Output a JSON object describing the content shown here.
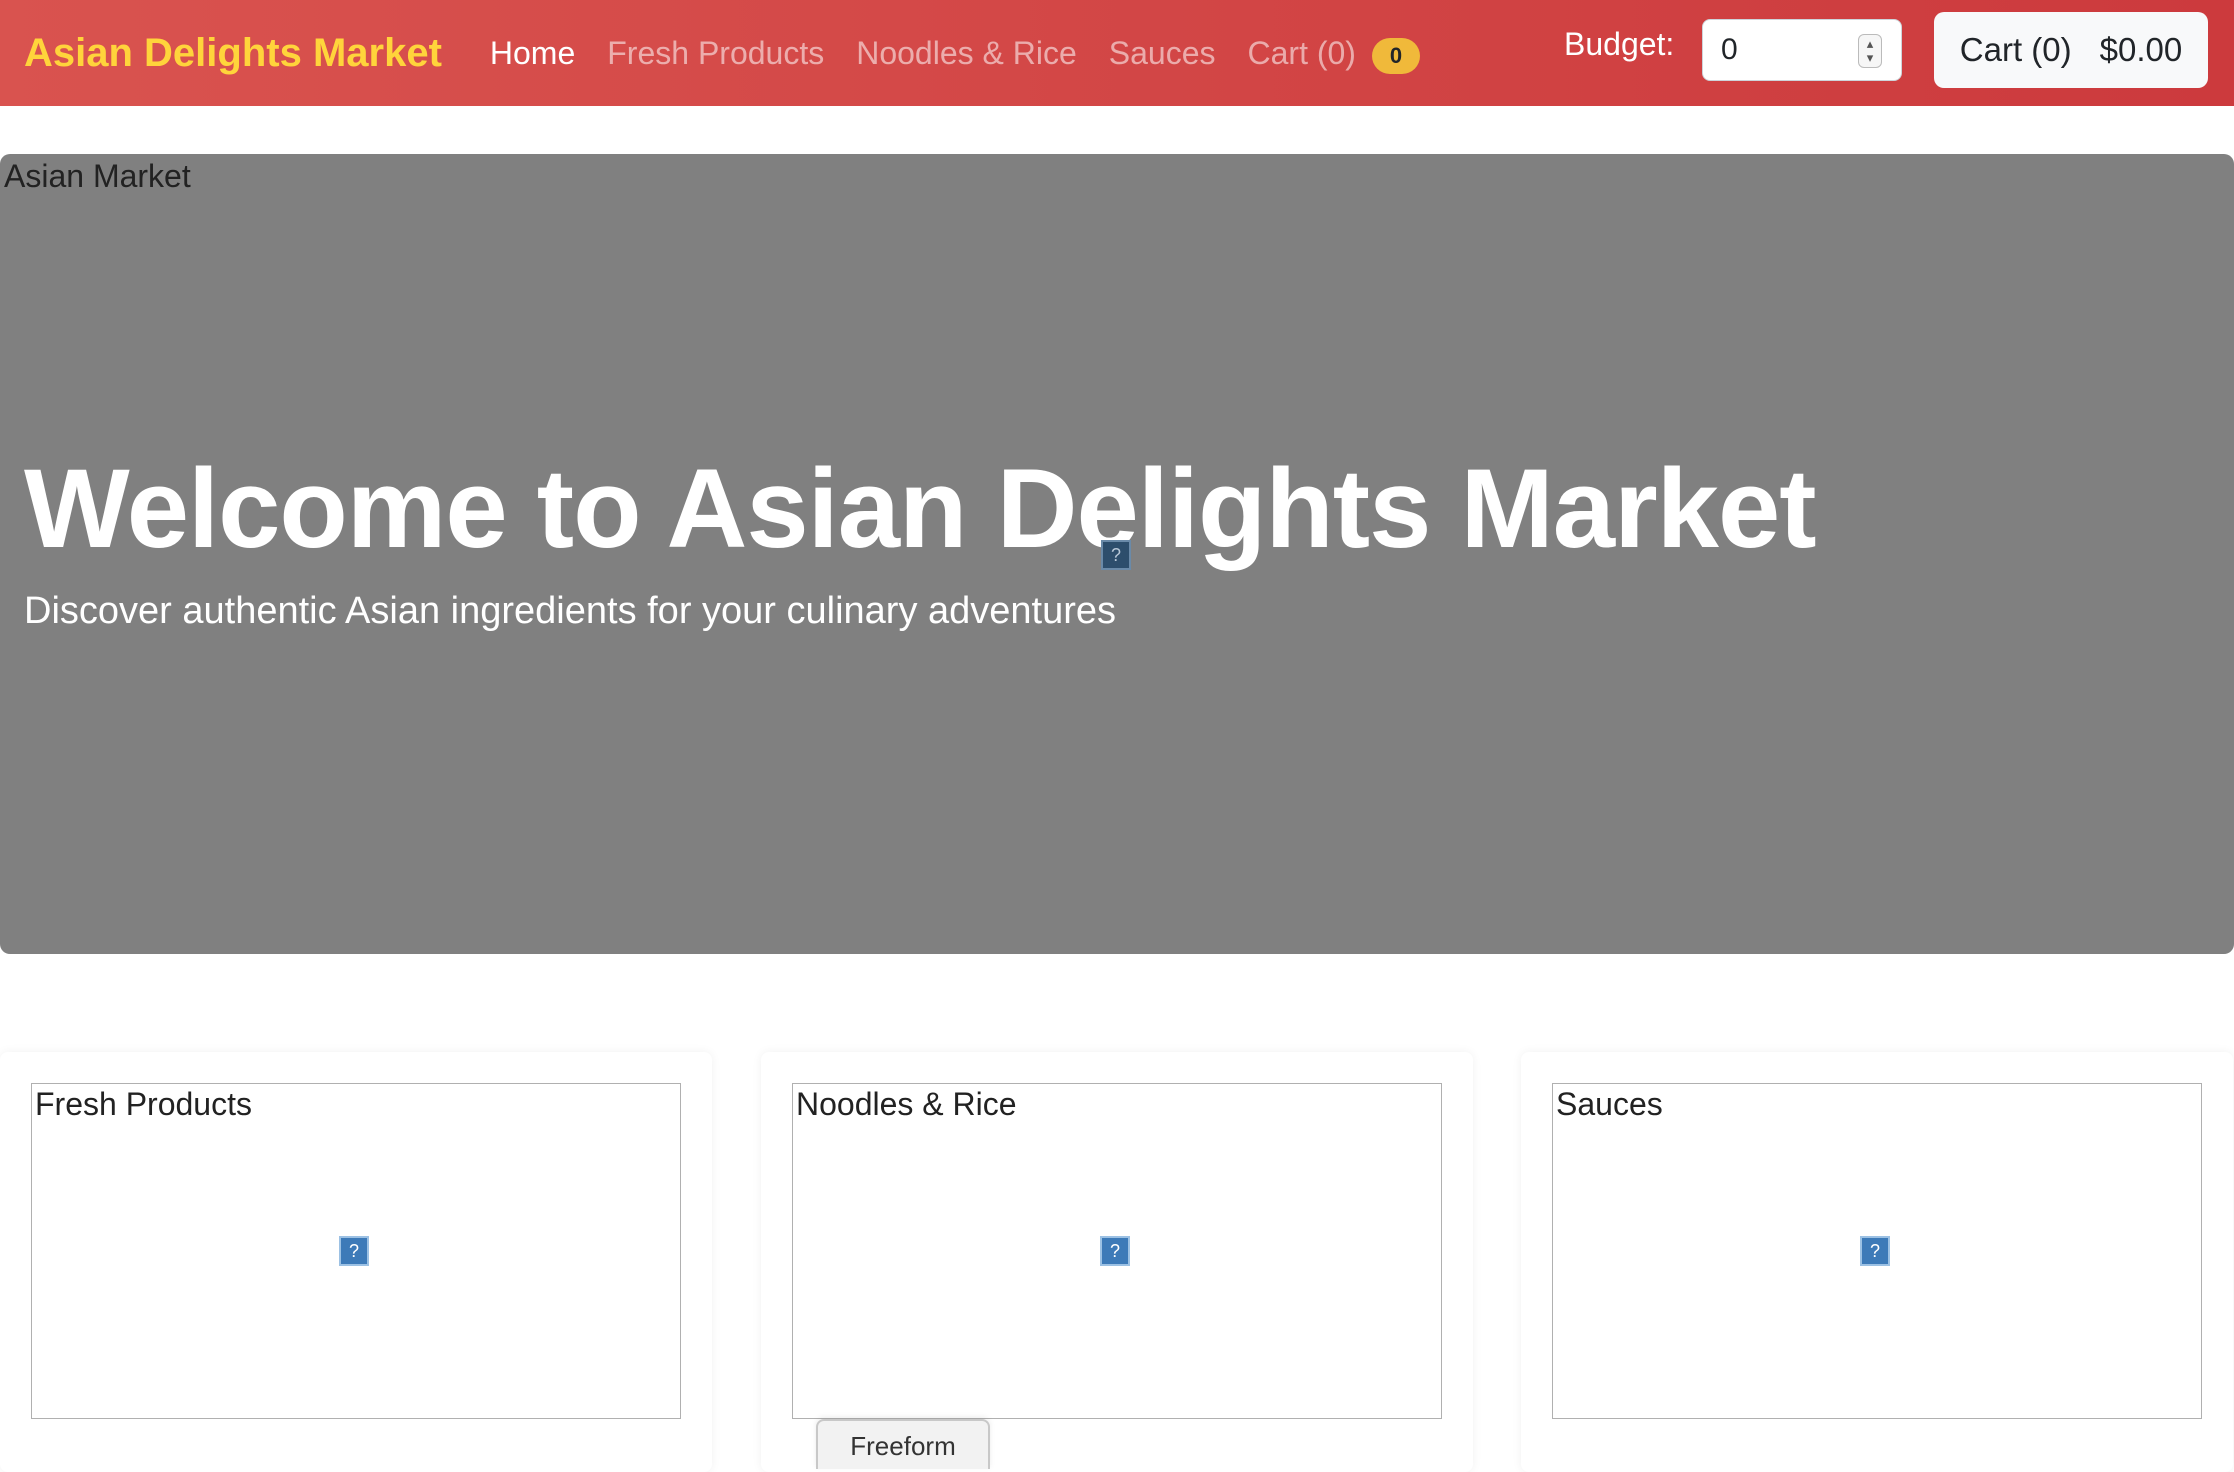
{
  "navbar": {
    "brand": "Asian Delights Market",
    "links": [
      {
        "label": "Home",
        "active": true
      },
      {
        "label": "Fresh Products",
        "active": false
      },
      {
        "label": "Noodles & Rice",
        "active": false
      },
      {
        "label": "Sauces",
        "active": false
      },
      {
        "label": "Cart (0)",
        "active": false
      }
    ],
    "cart_badge": "0",
    "budget_label": "Budget:",
    "budget_value": "0",
    "cart_button": {
      "label": "Cart (0)",
      "total": "$0.00"
    },
    "colors": {
      "background": "#d9534f",
      "brand": "#ffd43b",
      "badge": "#f0b93a"
    }
  },
  "hero": {
    "image_alt": "Asian Market",
    "title": "Welcome to Asian Delights Market",
    "subtitle": "Discover authentic Asian ingredients for your culinary adventures",
    "broken_image_glyph": "?",
    "background": "#808080"
  },
  "categories": [
    {
      "image_alt": "Fresh Products",
      "broken_image_glyph": "?"
    },
    {
      "image_alt": "Noodles & Rice",
      "broken_image_glyph": "?"
    },
    {
      "image_alt": "Sauces",
      "broken_image_glyph": "?"
    }
  ],
  "overlay": {
    "freeform_tab": "Freeform"
  }
}
